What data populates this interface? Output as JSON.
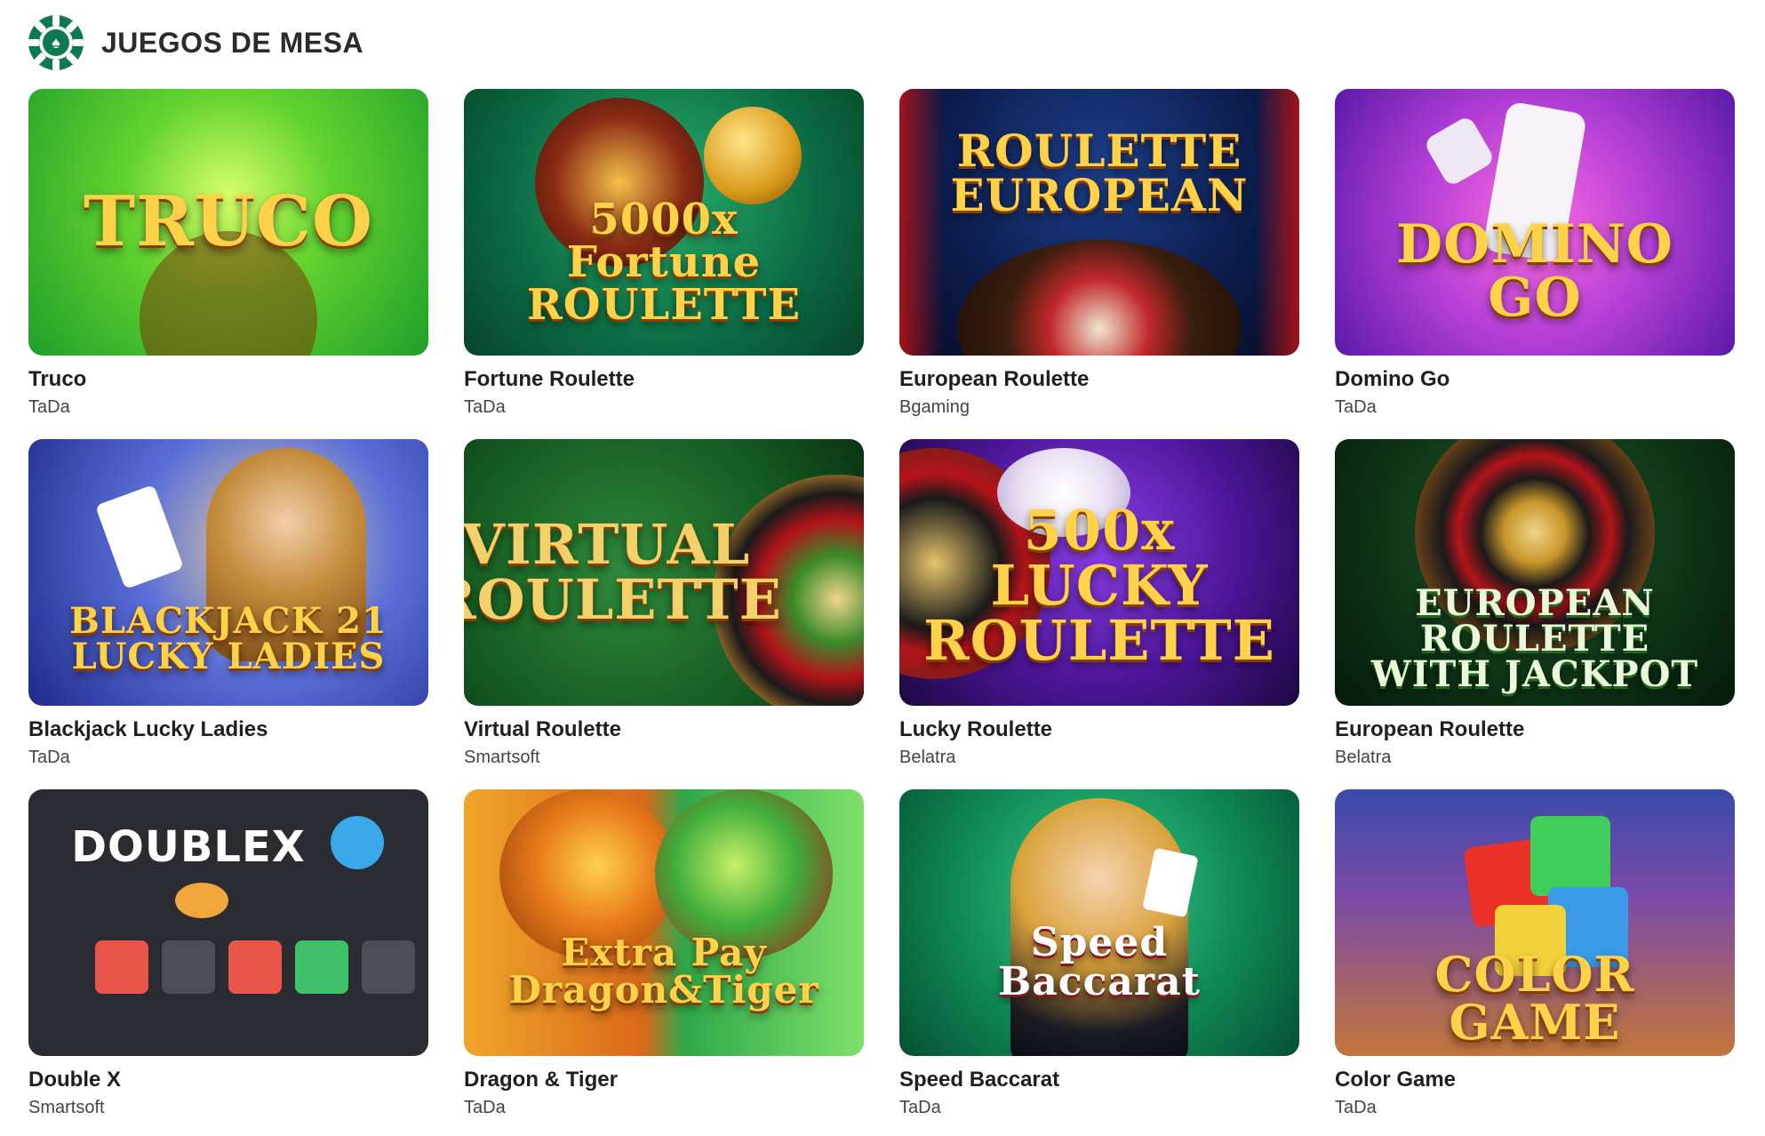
{
  "section": {
    "title": "JUEGOS DE MESA",
    "icon": "poker-chip-spade-icon",
    "accent_color": "#0b7a4f"
  },
  "games": [
    {
      "title": "Truco",
      "provider": "TaDa",
      "art_text": "TRUCO"
    },
    {
      "title": "Fortune Roulette",
      "provider": "TaDa",
      "art_text": "5000x\nFortune\nROULETTE"
    },
    {
      "title": "European Roulette",
      "provider": "Bgaming",
      "art_text": "ROULETTE\nEUROPEAN"
    },
    {
      "title": "Domino Go",
      "provider": "TaDa",
      "art_text": "DOMINO\nGO"
    },
    {
      "title": "Blackjack Lucky Ladies",
      "provider": "TaDa",
      "art_text": "BLACKJACK 21\nLUCKY LADIES"
    },
    {
      "title": "Virtual Roulette",
      "provider": "Smartsoft",
      "art_text": "VIRTUAL\nROULETTE"
    },
    {
      "title": "Lucky Roulette",
      "provider": "Belatra",
      "art_text": "500x\nLUCKY\nROULETTE"
    },
    {
      "title": "European Roulette",
      "provider": "Belatra",
      "art_text": "EUROPEAN\nROULETTE\nWITH JACKPOT"
    },
    {
      "title": "Double X",
      "provider": "Smartsoft",
      "art_text": "DOUBLEX"
    },
    {
      "title": "Dragon & Tiger",
      "provider": "TaDa",
      "art_text": "Extra Pay\nDragon&Tiger"
    },
    {
      "title": "Speed Baccarat",
      "provider": "TaDa",
      "art_text": "Speed\nBaccarat"
    },
    {
      "title": "Color Game",
      "provider": "TaDa",
      "art_text": "COLOR\nGAME"
    }
  ]
}
